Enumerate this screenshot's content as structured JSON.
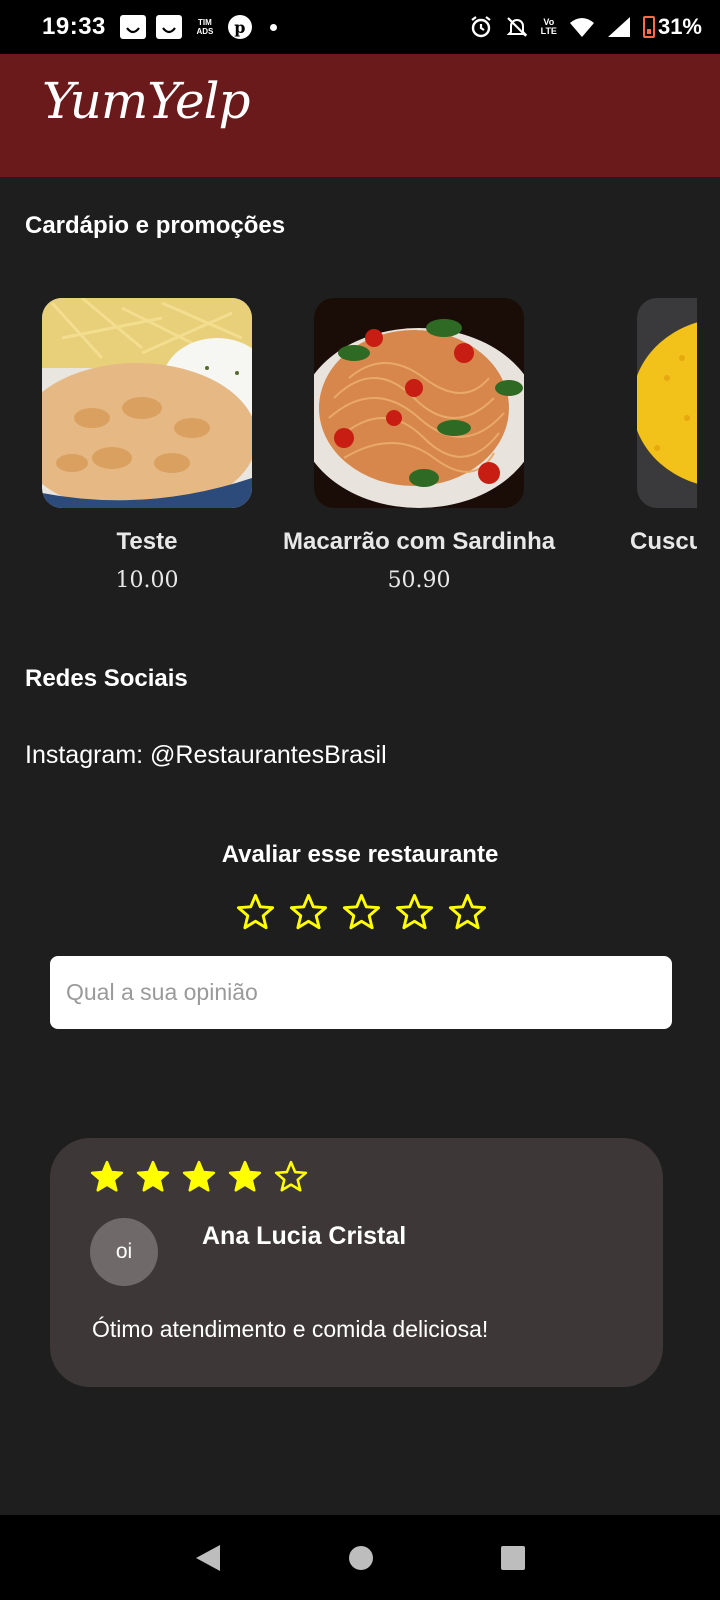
{
  "status_bar": {
    "time": "19:33",
    "carrier_badge": "TIM\nADS",
    "volte_badge": "Vo\nLTE",
    "battery": "31%"
  },
  "header": {
    "logo": "YumYelp"
  },
  "menu_section": {
    "title": "Cardápio e promoções",
    "items": [
      {
        "name": "Teste",
        "price": "10.00",
        "image": "strogonoff-dish"
      },
      {
        "name": "Macarrão com Sardinha",
        "price": "50.90",
        "image": "spaghetti-dish"
      },
      {
        "name": "Cuscuz",
        "price": "",
        "image": "couscous-dish"
      }
    ]
  },
  "social_section": {
    "title": "Redes Sociais",
    "instagram": "Instagram: @RestaurantesBrasil"
  },
  "rating": {
    "title": "Avaliar esse restaurante",
    "current": 0,
    "max": 5,
    "star_color": "#ffff00",
    "input_placeholder": "Qual a sua opinião"
  },
  "review": {
    "stars": 4,
    "max": 5,
    "avatar_text": "oi",
    "author": "Ana Lucia Cristal",
    "text": "Ótimo atendimento e comida deliciosa!"
  },
  "nav_bar": {
    "back": "back-icon",
    "home": "home-icon",
    "recents": "recents-icon"
  }
}
